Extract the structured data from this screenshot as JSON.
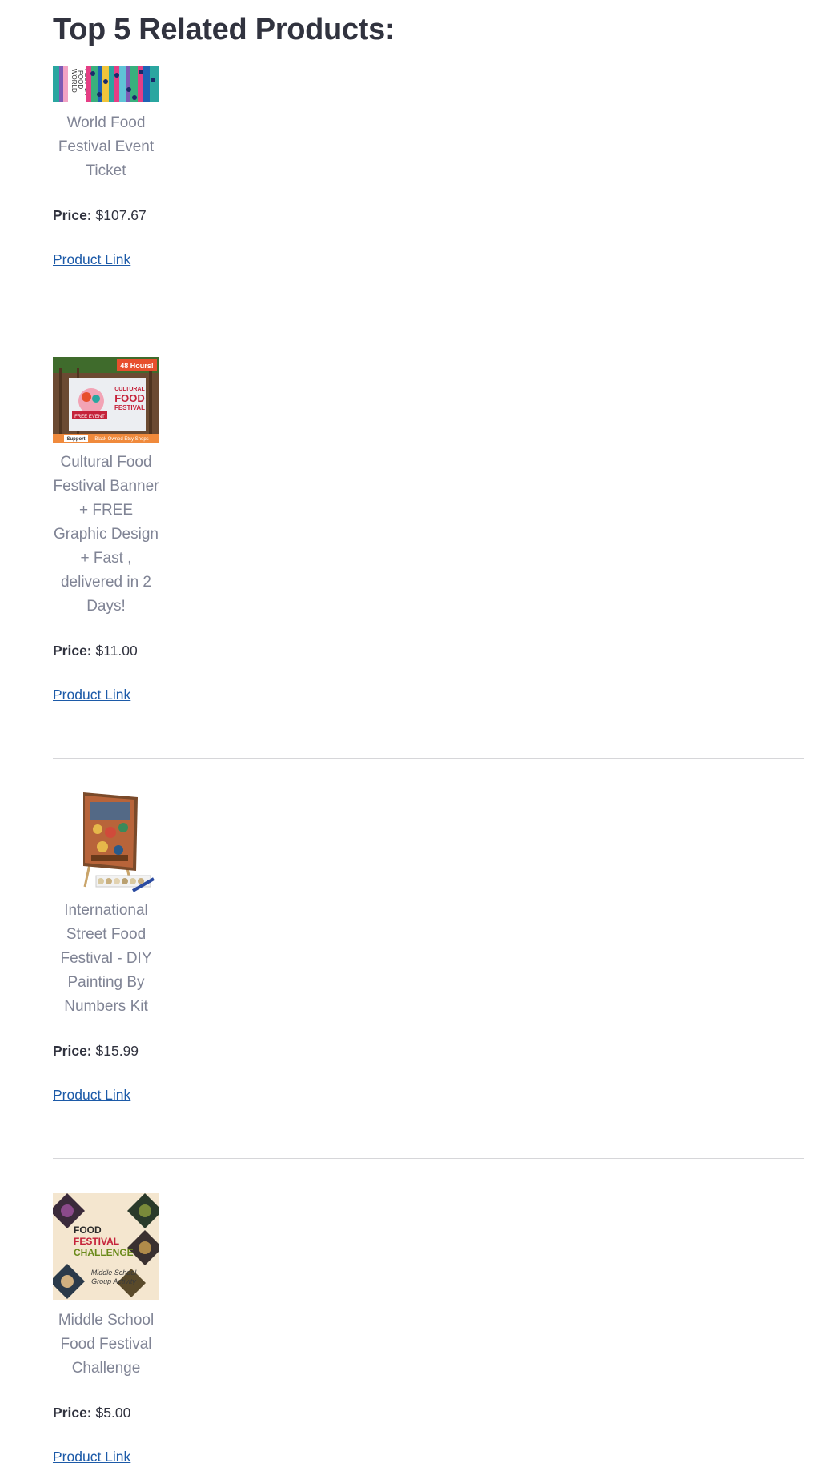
{
  "heading": "Top 5 Related Products:",
  "price_label": "Price:",
  "products": [
    {
      "name": "World Food Festival Event Ticket",
      "price": "$107.67",
      "link_label": "Product Link",
      "image_text": [
        "WORLD",
        "FOOD",
        "FESTIVA"
      ]
    },
    {
      "name": "Cultural Food Festival Banner + FREE Graphic Design + Fast , delivered in 2 Days!",
      "price": "$11.00",
      "link_label": "Product Link",
      "image_text": {
        "badge": "48 Hours!",
        "title1": "CULTURAL",
        "title2": "FOOD",
        "title3": "FESTIVAL",
        "ribbon": "FREE EVENT",
        "footer_a": "Support",
        "footer_b": "Black Owned Etsy Shops"
      }
    },
    {
      "name": "International Street Food Festival - DIY Painting By Numbers Kit",
      "price": "$15.99",
      "link_label": "Product Link"
    },
    {
      "name": "Middle School Food Festival Challenge",
      "price": "$5.00",
      "link_label": "Product Link",
      "image_text": {
        "line1": "FOOD",
        "line2": "FESTIVAL",
        "line3": "CHALLENGE",
        "sub1": "Middle School",
        "sub2": "Group Activity"
      }
    }
  ]
}
